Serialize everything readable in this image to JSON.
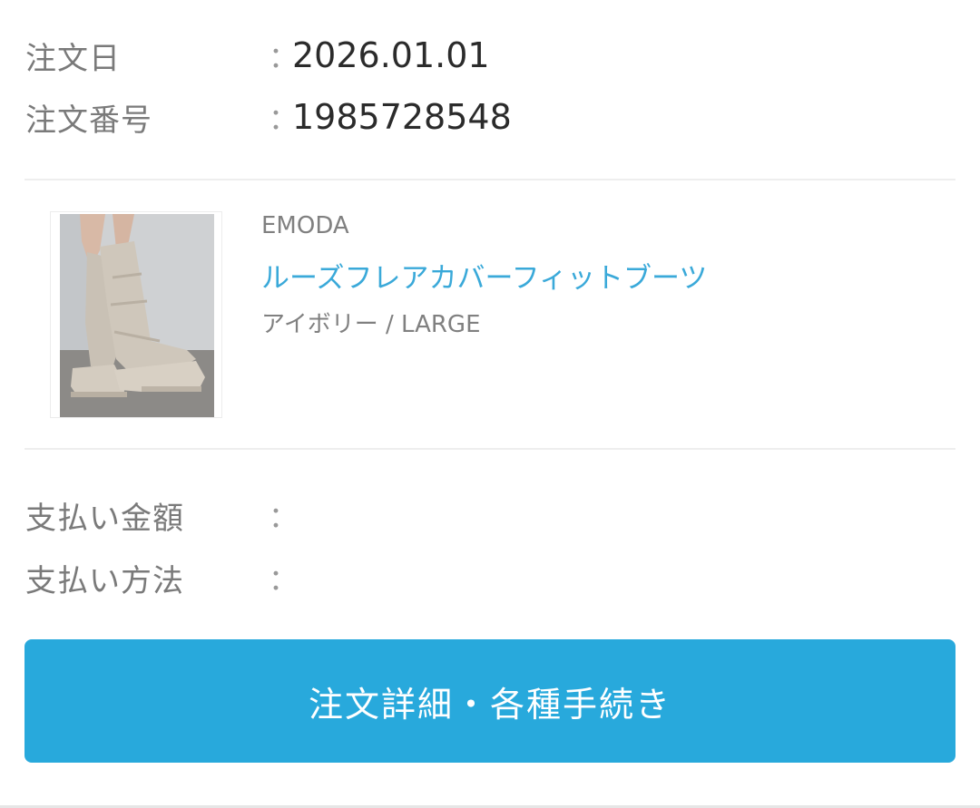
{
  "order": {
    "date_label": "注文日",
    "date_value": "2026.01.01",
    "number_label": "注文番号",
    "number_value": "1985728548",
    "colon": "："
  },
  "product": {
    "brand": "EMODA",
    "name": "ルーズフレアカバーフィットブーツ",
    "variant": "アイボリー / LARGE",
    "image_icon": "boots-product-image"
  },
  "payment": {
    "amount_label": "支払い金額",
    "amount_value": "",
    "method_label": "支払い方法",
    "method_value": ""
  },
  "actions": {
    "detail_button_label": "注文詳細・各種手続き"
  },
  "colors": {
    "accent": "#28a9dc",
    "link": "#3aa9d9"
  }
}
